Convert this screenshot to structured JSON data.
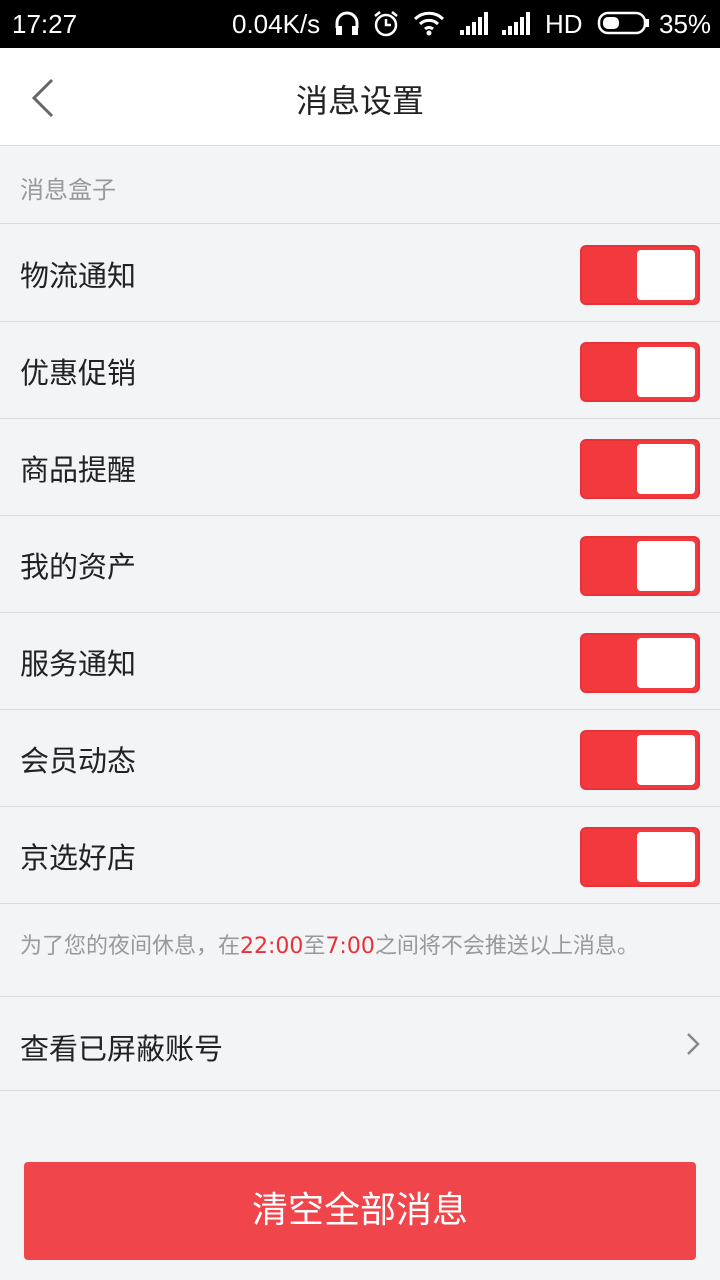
{
  "status_bar": {
    "time": "17:27",
    "net_speed": "0.04K/s",
    "hd_label": "HD",
    "battery": "35%",
    "icons": [
      "headphones-icon",
      "alarm-icon",
      "wifi-icon",
      "signal-icon",
      "signal-icon",
      "battery-icon"
    ]
  },
  "header": {
    "title": "消息设置",
    "back_icon": "chevron-left-icon"
  },
  "section": {
    "title": "消息盒子"
  },
  "settings": [
    {
      "label": "物流通知",
      "enabled": true
    },
    {
      "label": "优惠促销",
      "enabled": true
    },
    {
      "label": "商品提醒",
      "enabled": true
    },
    {
      "label": "我的资产",
      "enabled": true
    },
    {
      "label": "服务通知",
      "enabled": true
    },
    {
      "label": "会员动态",
      "enabled": true
    },
    {
      "label": "京选好店",
      "enabled": true
    }
  ],
  "night_note": {
    "prefix": "为了您的夜间休息，在",
    "start": "22:00",
    "middle": "至",
    "end": "7:00",
    "suffix": "之间将不会推送以上消息。"
  },
  "blocked": {
    "label": "查看已屏蔽账号",
    "icon": "chevron-right-icon"
  },
  "clear_button": {
    "label": "清空全部消息"
  },
  "colors": {
    "accent": "#f23a3e",
    "button": "#f0454a",
    "background": "#f3f4f6"
  }
}
